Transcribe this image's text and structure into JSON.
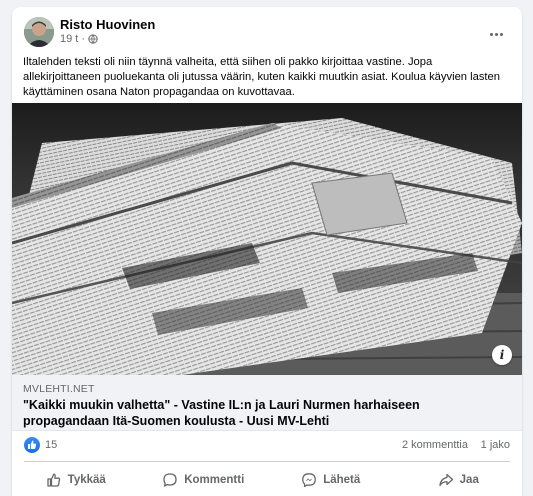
{
  "post": {
    "author": "Risto Huovinen",
    "time": "19 t",
    "separator": "·",
    "text": "Iltalehden teksti oli niin täynnä valheita, että siihen oli pakko kirjoittaa vastine. Jopa allekirjoittaneen puoluekanta oli jutussa väärin, kuten kaikki muutkin asiat. Koulua käyvien lasten käyttäminen osana Naton propagandaa on kuvottavaa."
  },
  "link": {
    "domain": "MVLEHTI.NET",
    "title": "\"Kaikki muukin valhetta\" - Vastine IL:n ja Lauri Nurmen harhaiseen propagandaan Itä-Suomen koulusta - Uusi MV-Lehti"
  },
  "image": {
    "info_icon_text": "i"
  },
  "stats": {
    "likes": "15",
    "comments": "2 kommenttia",
    "shares": "1 jako"
  },
  "actions": {
    "like": "Tykkää",
    "comment": "Kommentti",
    "send": "Lähetä",
    "share": "Jaa"
  },
  "colors": {
    "accent": "#1877f2",
    "secondary_text": "#65676b",
    "background": "#f0f2f5"
  }
}
